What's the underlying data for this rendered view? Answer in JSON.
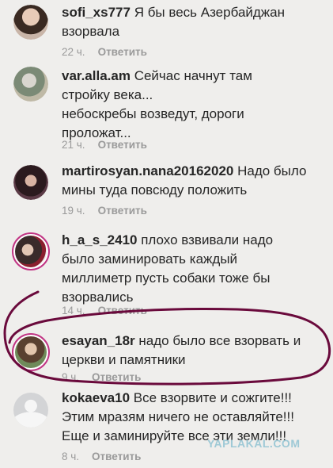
{
  "comments": [
    {
      "username": "sofi_xs777",
      "lines": [
        "Я бы весь Азербайджан",
        "взорвала"
      ],
      "time": "22 ч.",
      "reply": "Ответить"
    },
    {
      "username": "var.alla.am",
      "lines": [
        "Сейчас начнут там",
        "стройку века...",
        "небоскребы возведут, дороги",
        "проложат..."
      ],
      "time": "21 ч.",
      "reply": "Ответить"
    },
    {
      "username": "martirosyan.nana20162020",
      "lines": [
        "Надо было",
        "мины туда повсюду положить"
      ],
      "time": "19 ч.",
      "reply": "Ответить"
    },
    {
      "username": "h_a_s_2410",
      "lines": [
        "плохо взвивали надо",
        "было  заминировать каждый",
        "миллиметр пусть собаки тоже бы",
        "взорвались"
      ],
      "time": "14 ч.",
      "reply": "Ответить"
    },
    {
      "username": "esayan_18r",
      "lines": [
        "надо было все взорвать и",
        "церкви и памятники"
      ],
      "time": "9 ч.",
      "reply": "Ответить"
    },
    {
      "username": "kokaeva10",
      "lines": [
        "Все взорвите и сожгите!!!",
        "Этим мразям ничего не оставляйте!!!",
        "Еще и заминируйте все эти земли!!!"
      ],
      "time": "8 ч.",
      "reply": "Ответить"
    }
  ],
  "watermark": "YAPLAKAL.COM",
  "colors": {
    "background": "#efeeec",
    "text": "#262626",
    "meta": "#9a9a9a",
    "ring": "#c13584",
    "scribble": "#6a0a3c"
  }
}
